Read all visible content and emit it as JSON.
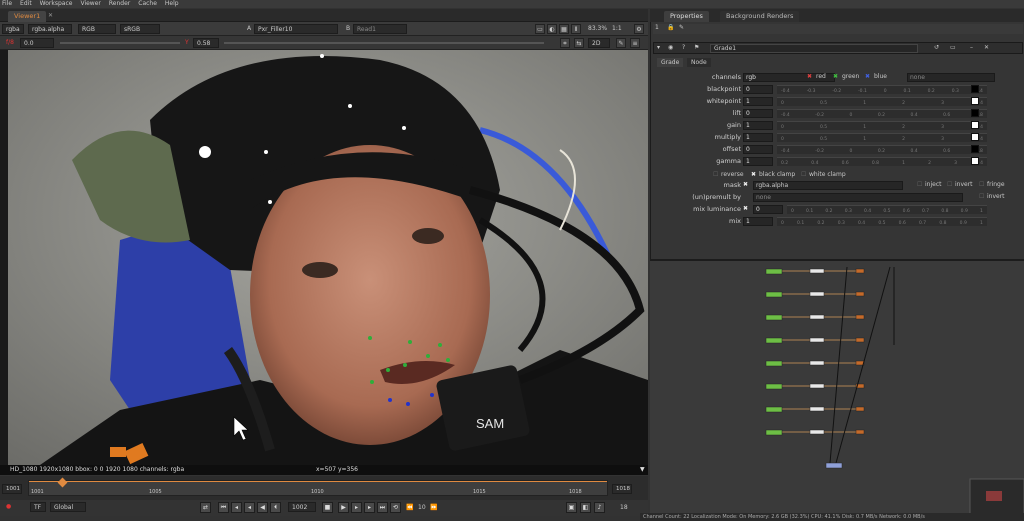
{
  "menu": [
    "File",
    "Edit",
    "Workspace",
    "Viewer",
    "Render",
    "Cache",
    "Help"
  ],
  "viewer_tab": "Viewer1",
  "viewer_bar1": {
    "channels": "rgba",
    "layer": "rgba.alpha",
    "display": "RGB",
    "colorspace": "sRGB",
    "input_a": "A",
    "input_a_node": "Pxr_Filler10",
    "input_b": "B",
    "input_b_node": "Read1",
    "zoom": "83.3%",
    "ratio": "1:1"
  },
  "viewer_bar2": {
    "fstop_label": "f/8",
    "gain": "0.0",
    "gamma_label": "Y",
    "gamma": "0.58",
    "view_mode": "2D"
  },
  "viewer_status": {
    "format": "HD_1080 1920x1080  bbox: 0 0 1920 1080 channels: rgba",
    "coords": "x=507 y=356"
  },
  "timeline": {
    "start": "1001",
    "end": "1018",
    "ticks": [
      "1001",
      "1005",
      "1010",
      "1015",
      "1018"
    ],
    "current_frame": "1002",
    "in_out_label": "TF",
    "scope": "Global",
    "frame_field": "1002",
    "step": "10",
    "fps": "18"
  },
  "properties_tabs": [
    "Properties",
    "Background Renders"
  ],
  "properties": {
    "node_name": "Grade1",
    "tabs": [
      "Grade",
      "Node"
    ],
    "channels_label": "channels",
    "channels_value": "rgb",
    "channel_checks": [
      "red",
      "green",
      "blue"
    ],
    "channel_none": "none",
    "knobs": [
      {
        "label": "blackpoint",
        "value": "0"
      },
      {
        "label": "whitepoint",
        "value": "1"
      },
      {
        "label": "lift",
        "value": "0"
      },
      {
        "label": "gain",
        "value": "1"
      },
      {
        "label": "multiply",
        "value": "1"
      },
      {
        "label": "offset",
        "value": "0"
      },
      {
        "label": "gamma",
        "value": "1"
      }
    ],
    "reverse": "reverse",
    "black_clamp": "black clamp",
    "white_clamp": "white clamp",
    "mask_label": "mask",
    "mask_value": "rgba.alpha",
    "inject": "inject",
    "invert": "invert",
    "fringe": "fringe",
    "unpremult_label": "(un)premult by",
    "unpremult_value": "none",
    "unpremult_invert": "invert",
    "mix_luminance_label": "mix luminance",
    "mix_luminance_value": "0",
    "mix_label": "mix",
    "mix_value": "1"
  },
  "bottom_status": "Channel Count: 22  Localization Mode: On  Memory: 2.6 GB (32.3%)  CPU: 41.1%  Disk: 0.7 MB/s  Network: 0.0 MB/s",
  "colors": {
    "accent": "#e08a40",
    "node_green": "#6dbe45",
    "node_white": "#e8e8e8",
    "graph_bg": "#3a3a3a"
  }
}
